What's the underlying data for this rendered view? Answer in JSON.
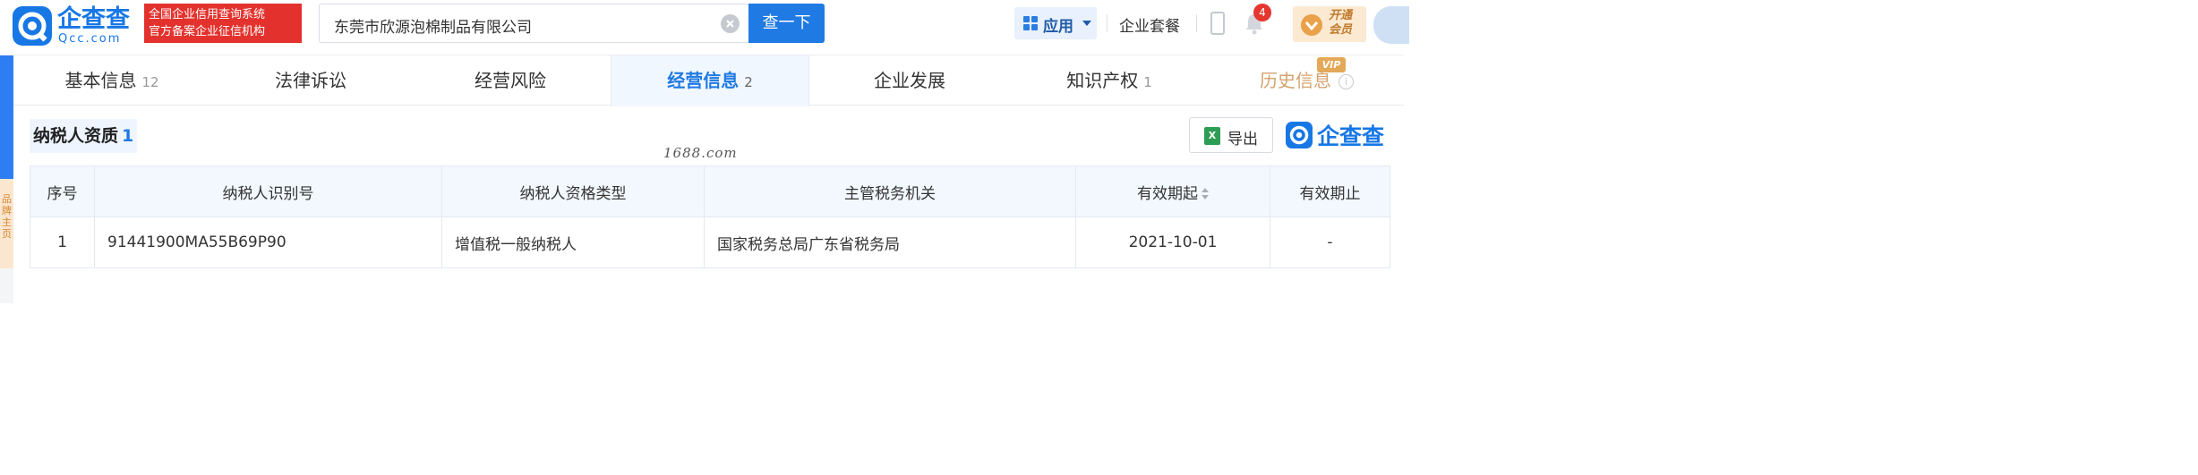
{
  "header": {
    "logo_name": "企查查",
    "logo_domain": "Qcc.com",
    "slogan_line1": "全国企业信用查询系统",
    "slogan_line2": "官方备案企业征信机构",
    "search_value": "东莞市欣源泡棉制品有限公司",
    "search_button": "查一下",
    "app_label": "应用",
    "suite_label": "企业套餐",
    "notification_count": "4",
    "vip_line1": "开通",
    "vip_line2": "会员"
  },
  "sidebar": {
    "orange_label": "品牌主页"
  },
  "tabs": [
    {
      "label": "基本信息",
      "count": "12"
    },
    {
      "label": "法律诉讼",
      "count": ""
    },
    {
      "label": "经营风险",
      "count": ""
    },
    {
      "label": "经营信息",
      "count": "2",
      "active": true
    },
    {
      "label": "企业发展",
      "count": ""
    },
    {
      "label": "知识产权",
      "count": "1"
    },
    {
      "label": "历史信息",
      "count": "",
      "tag": "VIP"
    }
  ],
  "section": {
    "title": "纳税人资质",
    "count": "1",
    "watermark": "1688.com",
    "export_label": "导出",
    "brand_name": "企查查"
  },
  "table": {
    "columns": [
      "序号",
      "纳税人识别号",
      "纳税人资格类型",
      "主管税务机关",
      "有效期起",
      "有效期止"
    ],
    "rows": [
      {
        "index": "1",
        "tax_id": "91441900MA55B69P90",
        "type": "增值税一般纳税人",
        "authority": "国家税务总局广东省税务局",
        "start": "2021-10-01",
        "end": "-"
      }
    ]
  },
  "colors": {
    "brand_blue": "#1777e5",
    "search_button": "#1f7ae3",
    "slogan_red": "#e3322d",
    "vip_gold": "#e3a858"
  }
}
